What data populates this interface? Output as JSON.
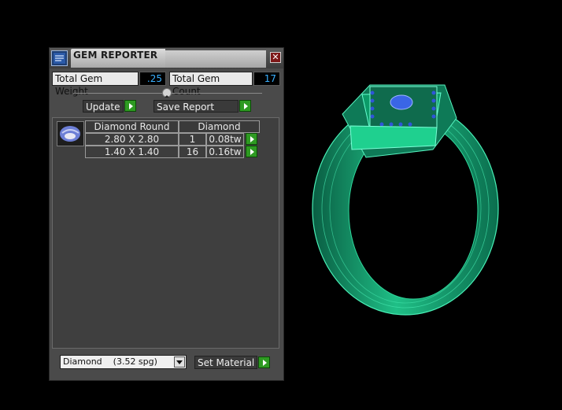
{
  "window": {
    "title": "GEM REPORTER",
    "close_glyph": "✕"
  },
  "summary": {
    "total_weight_label": "Total Gem Weight",
    "total_weight_value": ".25",
    "total_count_label": "Total Gem Count",
    "total_count_value": "17"
  },
  "toolbar": {
    "update_label": "Update",
    "save_label": "Save Report"
  },
  "table": {
    "header": [
      "Diamond Round",
      "Diamond"
    ],
    "rows": [
      {
        "size": "2.80 X 2.80",
        "count": "1",
        "weight": "0.08tw"
      },
      {
        "size": "1.40 X 1.40",
        "count": "16",
        "weight": "0.16tw"
      }
    ]
  },
  "material": {
    "selected": "Diamond    (3.52 spg)",
    "set_label": "Set Material"
  },
  "colors": {
    "ring_green": "#0f8a63",
    "ring_light": "#22d39b",
    "accent_blue": "#3ab0ff",
    "go_green": "#2e9a22"
  }
}
